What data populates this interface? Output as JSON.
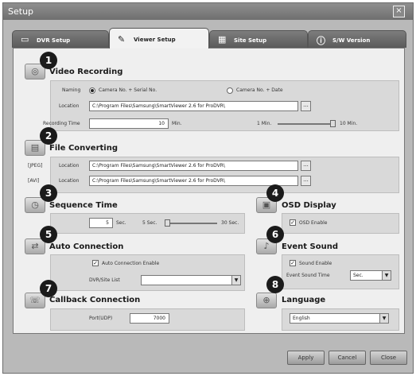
{
  "window": {
    "title": "Setup",
    "close_glyph": "×"
  },
  "tabs": [
    {
      "label": "DVR Setup"
    },
    {
      "label": "Viewer Setup"
    },
    {
      "label": "Site Setup"
    },
    {
      "label": "S/W Version"
    }
  ],
  "markers": [
    "1",
    "2",
    "3",
    "4",
    "5",
    "6",
    "7",
    "8"
  ],
  "video_recording": {
    "title": "Video Recording",
    "naming_label": "Naming",
    "naming_option_1": "Camera No. + Serial No.",
    "naming_option_2": "Camera No. + Date",
    "location_label": "Location",
    "location_value": "C:\\Program Files\\Samsung\\SmartViewer 2.6 for ProDVR\\",
    "recording_time_label": "Recording Time",
    "recording_time_value": "10",
    "recording_time_unit": "Min.",
    "slider_min": "1 Min.",
    "slider_max": "10 Min."
  },
  "file_converting": {
    "title": "File Converting",
    "jpeg_label": "[JPEG]",
    "jpeg_location_label": "Location",
    "jpeg_location_value": "C:\\Program Files\\Samsung\\SmartViewer 2.6 for ProDVR\\",
    "avi_label": "[AVI]",
    "avi_location_label": "Location",
    "avi_location_value": "C:\\Program Files\\Samsung\\SmartViewer 2.6 for ProDVR\\"
  },
  "sequence_time": {
    "title": "Sequence Time",
    "value": "5",
    "unit": "Sec.",
    "slider_min": "5 Sec.",
    "slider_max": "30 Sec."
  },
  "osd_display": {
    "title": "OSD Display",
    "checkbox_label": "OSD Enable"
  },
  "auto_connection": {
    "title": "Auto Connection",
    "checkbox_label": "Auto Connection Enable",
    "site_list_label": "DVR/Site List",
    "site_list_value": ""
  },
  "event_sound": {
    "title": "Event Sound",
    "checkbox_label": "Sound Enable",
    "time_label": "Event Sound Time",
    "time_value": "Sec."
  },
  "callback_connection": {
    "title": "Callback Connection",
    "port_label": "Port(UDP)",
    "port_value": "7000"
  },
  "language": {
    "title": "Language",
    "value": "English"
  },
  "buttons": {
    "apply": "Apply",
    "cancel": "Cancel",
    "close": "Close"
  },
  "glyphs": {
    "dots": "...",
    "arrow": "▼",
    "check": "✓"
  }
}
